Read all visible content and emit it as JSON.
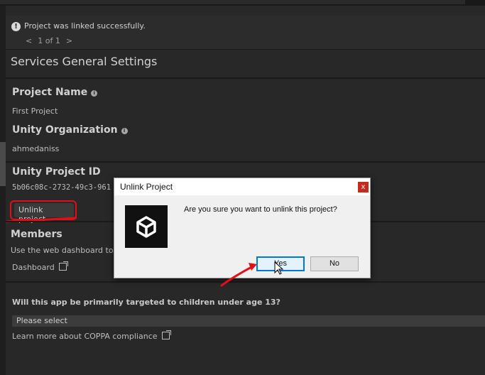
{
  "notification": {
    "icon": "alert-icon",
    "message": "Project was linked successfully.",
    "pager_prev": "<",
    "pager_text": "1 of 1",
    "pager_next": ">"
  },
  "services": {
    "title": "Services General Settings",
    "project_name_label": "Project Name",
    "project_name_value": "First Project",
    "org_label": "Unity Organization",
    "org_value": "ahmedaniss",
    "project_id_label": "Unity Project ID",
    "project_id_value": "5b06c08c-2732-49c3-961",
    "unlink_button": "Unlink project",
    "members_label": "Members",
    "members_desc": "Use the web dashboard to a",
    "dashboard_link": "Dashboard",
    "coppa_question": "Will this app be primarily targeted to children under age 13?",
    "coppa_select": "Please select",
    "coppa_link": "Learn more about COPPA compliance"
  },
  "dialog": {
    "title": "Unlink Project",
    "close": "x",
    "message": "Are you sure you want to unlink this project?",
    "yes_label": "Yes",
    "no_label": "No"
  },
  "colors": {
    "annotation_red": "#e0101a",
    "focus_blue": "#0078d7",
    "close_red": "#c42b1c"
  }
}
